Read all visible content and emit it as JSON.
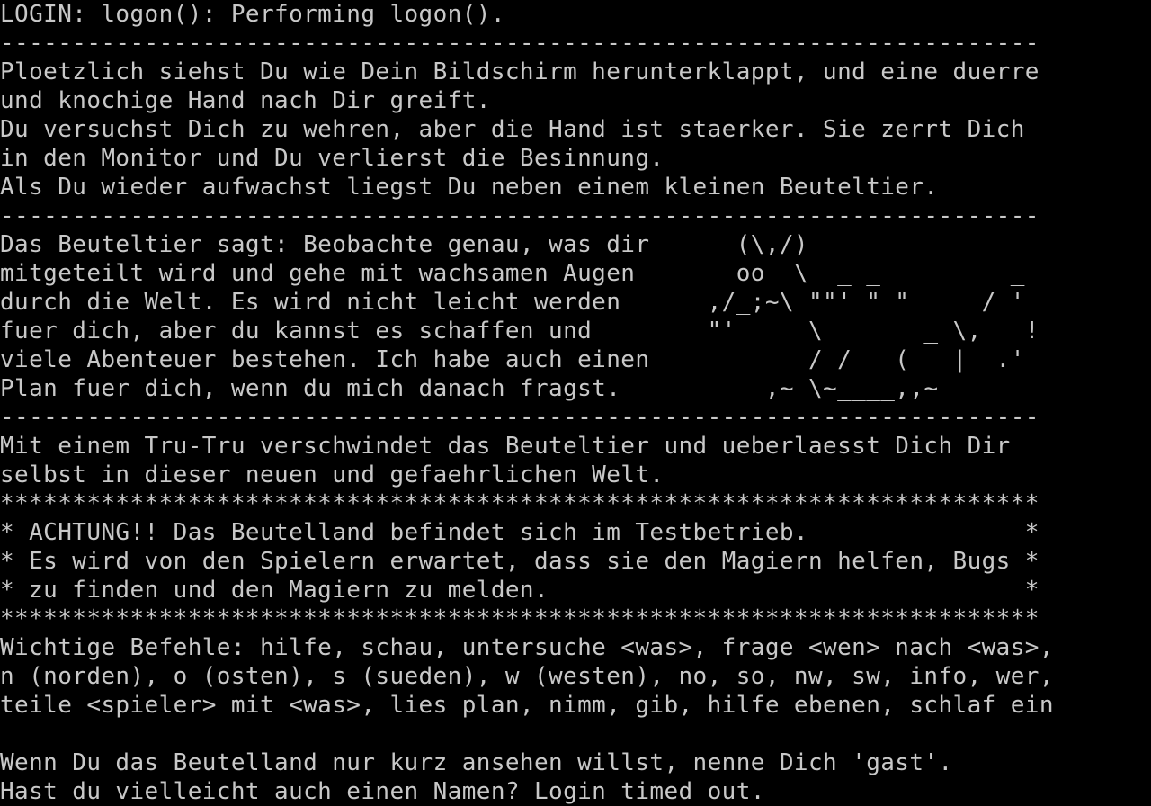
{
  "terminal": {
    "fg_color": "#c8c8c8",
    "bg_color": "#000000",
    "lines": [
      "LOGIN: logon(): Performing logon().",
      "------------------------------------------------------------------------",
      "Ploetzlich siehst Du wie Dein Bildschirm herunterklappt, und eine duerre",
      "und knochige Hand nach Dir greift.",
      "Du versuchst Dich zu wehren, aber die Hand ist staerker. Sie zerrt Dich",
      "in den Monitor und Du verlierst die Besinnung.",
      "Als Du wieder aufwachst liegst Du neben einem kleinen Beuteltier.",
      "------------------------------------------------------------------------",
      "Das Beuteltier sagt: Beobachte genau, was dir      (\\,/)",
      "mitgeteilt wird und gehe mit wachsamen Augen       oo  \\  _ _         _",
      "durch die Welt. Es wird nicht leicht werden      ,/_;~\\ \"\"' \" \"     / '",
      "fuer dich, aber du kannst es schaffen und        \"'     \\       _ \\,   !",
      "viele Abenteuer bestehen. Ich habe auch einen           / /   (   |__.'",
      "Plan fuer dich, wenn du mich danach fragst.          ,~ \\~____,,~",
      "------------------------------------------------------------------------",
      "Mit einem Tru-Tru verschwindet das Beuteltier und ueberlaesst Dich Dir",
      "selbst in dieser neuen und gefaehrlichen Welt.",
      "************************************************************************",
      "* ACHTUNG!! Das Beutelland befindet sich im Testbetrieb.               *",
      "* Es wird von den Spielern erwartet, dass sie den Magiern helfen, Bugs *",
      "* zu finden und den Magiern zu melden.                                 *",
      "************************************************************************",
      "Wichtige Befehle: hilfe, schau, untersuche <was>, frage <wen> nach <was>,",
      "n (norden), o (osten), s (sueden), w (westen), no, so, nw, sw, info, wer,",
      "teile <spieler> mit <was>, lies plan, nimm, gib, hilfe ebenen, schlaf ein",
      "",
      "Wenn Du das Beutelland nur kurz ansehen willst, nenne Dich 'gast'.",
      "Hast du vielleicht auch einen Namen? Login timed out."
    ]
  }
}
